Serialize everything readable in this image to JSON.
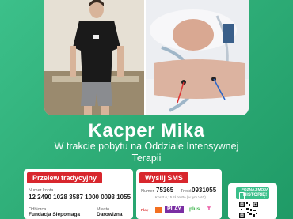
{
  "person": {
    "name": "Kacper Mika",
    "subtitle": "W trakcie pobytu na Oddziale Intensywnej Terapii"
  },
  "transfer": {
    "heading": "Przelew tradycyjny",
    "account_label": "Numer konta",
    "account_number": "12 2490 1028 3587 1000 0093 1055",
    "recipient_label": "Odbiorca",
    "recipient": "Fundacja Siepomaga",
    "city_label": "Miasto",
    "city": "Darowizna"
  },
  "sms": {
    "heading": "Wyślij SMS",
    "number_label": "Numer",
    "number": "75365",
    "content_label": "Treść",
    "content": "0931055",
    "note": "Koszt 6,15 zł brutto (w tym VAT)",
    "operators": [
      "Play",
      "PLAY",
      "plus",
      "T"
    ]
  },
  "qr": {
    "heading_line1": "POZNAJ MOJĄ",
    "heading_line2": "HISTORIĘ!"
  },
  "colors": {
    "background": "#2fae78",
    "accent_red": "#d8262d",
    "accent_green": "#3bbf8a"
  }
}
